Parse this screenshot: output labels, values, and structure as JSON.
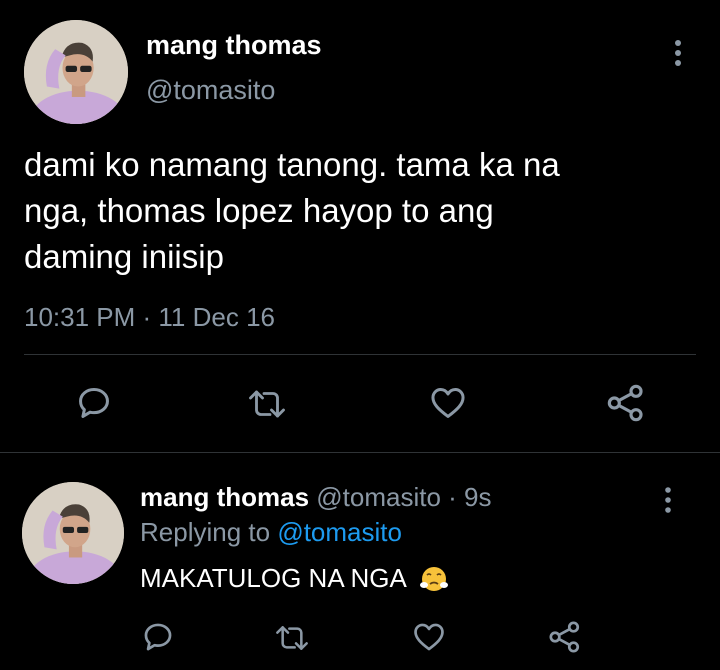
{
  "tweet": {
    "author_name": "mang thomas",
    "author_handle": "@tomasito",
    "text_lines": [
      "dami ko namang tanong. tama ka na",
      "nga, thomas lopez hayop to ang",
      "daming iniisip"
    ],
    "timestamp": "10:31 PM · 11 Dec 16",
    "actions": [
      "reply-icon",
      "retweet-icon",
      "like-icon",
      "share-icon"
    ]
  },
  "reply": {
    "author_name": "mang thomas",
    "author_handle": "@tomasito",
    "separator": " · ",
    "age": "9s",
    "replying_prefix": "Replying to ",
    "replying_handle": "@tomasito",
    "text": "MAKATULOG NA NGA",
    "emoji": "face-with-steam-from-nose",
    "actions": [
      "reply-icon",
      "retweet-icon",
      "like-icon",
      "share-icon"
    ]
  },
  "colors": {
    "background": "#000000",
    "text_primary": "#ffffff",
    "text_secondary": "#8b98a5",
    "link": "#1d9bf0",
    "divider": "#2f3336"
  }
}
